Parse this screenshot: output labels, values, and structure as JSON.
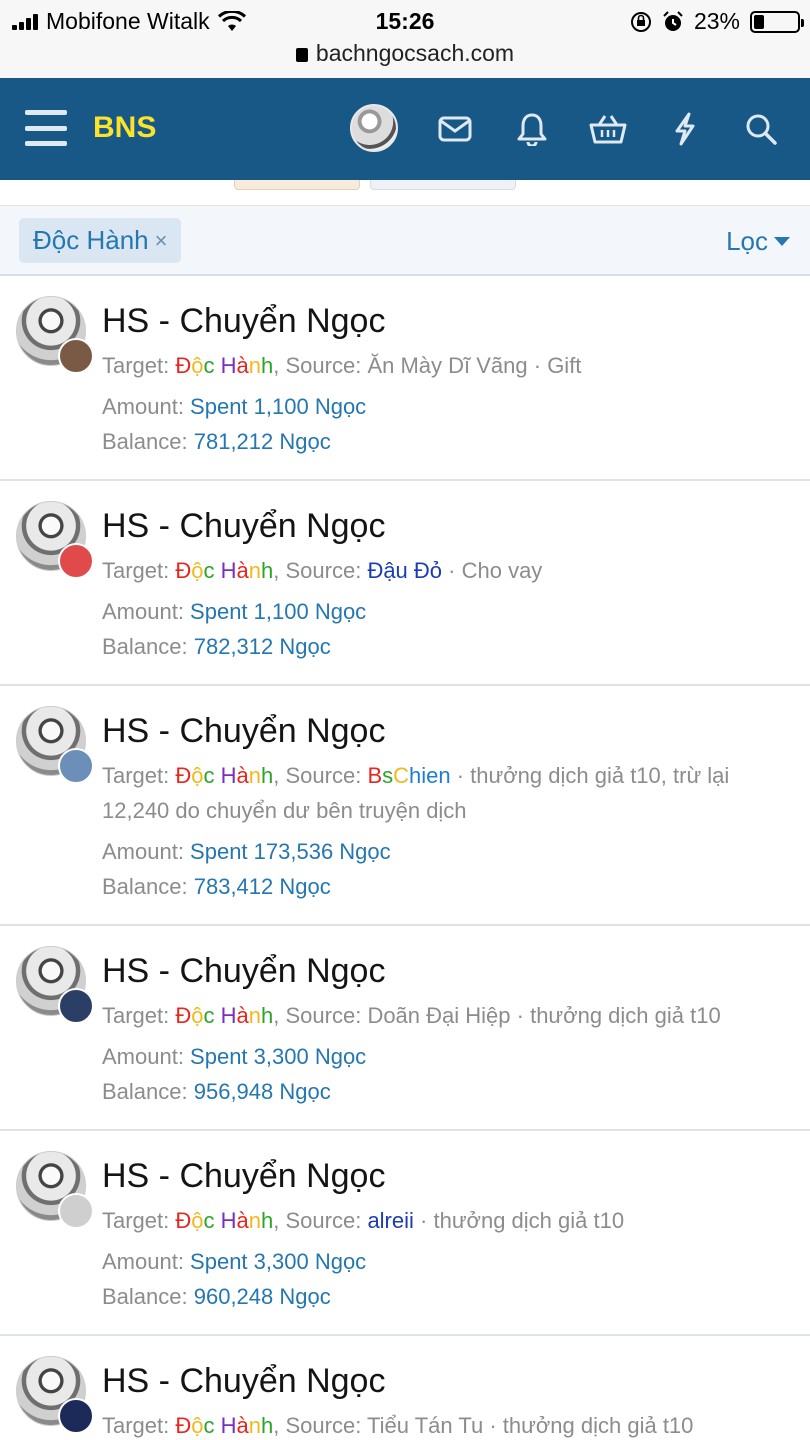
{
  "status_bar": {
    "carrier": "Mobifone Witalk",
    "time": "15:26",
    "url": "bachngocsach.com",
    "battery": "23%"
  },
  "header": {
    "brand": "BNS",
    "icons": [
      "menu-icon",
      "avatar",
      "mail-icon",
      "bell-icon",
      "basket-icon",
      "lightning-icon",
      "search-icon"
    ]
  },
  "filter": {
    "chip_label": "Độc Hành",
    "chip_remove": "×",
    "filter_label": "Lọc"
  },
  "labels": {
    "target": "Target: ",
    "source": ", Source: ",
    "amount": "Amount: ",
    "balance": "Balance: ",
    "sep": " · "
  },
  "target_name_parts": [
    "Đ",
    "ộ",
    "c",
    " ",
    "H",
    "à",
    "n",
    "h"
  ],
  "transactions": [
    {
      "title": "HS - Chuyển Ngọc",
      "source": "Ăn Mày Dĩ Vãng",
      "source_style": "plain",
      "note": "Gift",
      "amount": "Spent 1,100 Ngọc",
      "balance": "781,212 Ngọc"
    },
    {
      "title": "HS - Chuyển Ngọc",
      "source": "Đậu Đỏ",
      "source_style": "link",
      "note": "Cho vay",
      "amount": "Spent 1,100 Ngọc",
      "balance": "782,312 Ngọc"
    },
    {
      "title": "HS - Chuyển Ngọc",
      "source": "BsChien",
      "source_style": "rainbow",
      "note": "thưởng dịch giả t10, trừ lại 12,240 do chuyển dư bên truyện dịch",
      "amount": "Spent 173,536 Ngọc",
      "balance": "783,412 Ngọc"
    },
    {
      "title": "HS - Chuyển Ngọc",
      "source": "Doãn Đại Hiệp",
      "source_style": "plain",
      "note": "thưởng dịch giả t10",
      "amount": "Spent 3,300 Ngọc",
      "balance": "956,948 Ngọc"
    },
    {
      "title": "HS - Chuyển Ngọc",
      "source": "alreii",
      "source_style": "link",
      "note": "thưởng dịch giả t10",
      "amount": "Spent 3,300 Ngọc",
      "balance": "960,248 Ngọc"
    },
    {
      "title": "HS - Chuyển Ngọc",
      "source": "Tiểu Tán Tu",
      "source_style": "plain",
      "note": "thưởng dịch giả t10",
      "amount": "",
      "balance": ""
    }
  ]
}
